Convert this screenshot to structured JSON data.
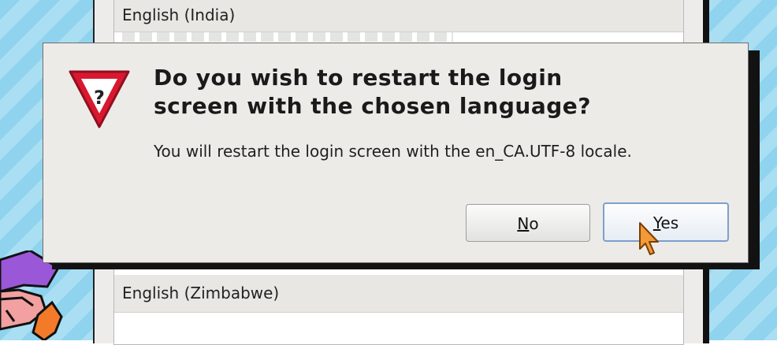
{
  "background_list": {
    "items": [
      {
        "label": "English (India)"
      },
      {
        "label": "English (Zimbabwe)"
      }
    ]
  },
  "dialog": {
    "icon": "question-warning-icon",
    "title_line1": "Do you wish to restart the login",
    "title_line2": "screen with the chosen language?",
    "message": "You will restart the login screen with the en_CA.UTF-8 locale.",
    "buttons": {
      "no": {
        "mnemonic": "N",
        "rest": "o"
      },
      "yes": {
        "mnemonic": "Y",
        "rest": "es"
      }
    }
  },
  "colors": {
    "dialog_bg": "#edebe8",
    "icon_red": "#d9182f",
    "focus_border": "#7ca0cc"
  }
}
